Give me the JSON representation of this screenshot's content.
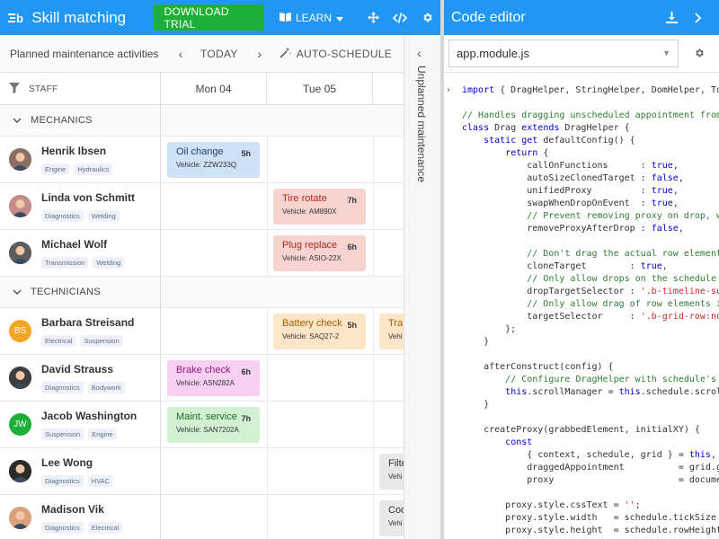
{
  "app": {
    "title": "Skill matching",
    "download_label": "DOWNLOAD TRIAL",
    "learn_label": "LEARN"
  },
  "toolbar": {
    "title": "Planned maintenance activities",
    "today_label": "TODAY",
    "auto_schedule_label": "AUTO-SCHEDULE"
  },
  "grid": {
    "staff_header": "STAFF",
    "days": [
      "Mon 04",
      "Tue 05"
    ]
  },
  "groups": [
    {
      "label": "MECHANICS",
      "staff": [
        {
          "name": "Henrik Ibsen",
          "tags": [
            "Engine",
            "Hydraulics"
          ],
          "avatar": "photo",
          "color": "#8d6e63",
          "events": [
            {
              "day": 0,
              "title": "Oil change",
              "duration": "5h",
              "vehicle": "Vehicle: ZZW233Q",
              "style": "blue"
            }
          ]
        },
        {
          "name": "Linda von Schmitt",
          "tags": [
            "Diagnostics",
            "Welding"
          ],
          "avatar": "photo",
          "color": "#c48b8b",
          "events": [
            {
              "day": 1,
              "title": "Tire rotate",
              "duration": "7h",
              "vehicle": "Vehicle: AM890X",
              "style": "red"
            }
          ]
        },
        {
          "name": "Michael Wolf",
          "tags": [
            "Transmission",
            "Welding"
          ],
          "avatar": "photo",
          "color": "#5d5d5d",
          "events": [
            {
              "day": 1,
              "title": "Plug replace",
              "duration": "6h",
              "vehicle": "Vehicle: ASIO-22X",
              "style": "red"
            }
          ]
        }
      ]
    },
    {
      "label": "TECHNICIANS",
      "staff": [
        {
          "name": "Barbara Streisand",
          "tags": [
            "Electrical",
            "Suspension"
          ],
          "avatar": "initials",
          "initials": "BS",
          "color": "#f4a523",
          "events": [
            {
              "day": 1,
              "title": "Battery check",
              "duration": "5h",
              "vehicle": "Vehicle: SAQ27-2",
              "style": "orange"
            },
            {
              "day": 2,
              "title": "Tra",
              "duration": "",
              "vehicle": "Vehi",
              "style": "orange"
            }
          ]
        },
        {
          "name": "David Strauss",
          "tags": [
            "Diagnostics",
            "Bodywork"
          ],
          "avatar": "photo",
          "color": "#3e3e3e",
          "events": [
            {
              "day": 0,
              "title": "Brake check",
              "duration": "6h",
              "vehicle": "Vehicle: ASN282A",
              "style": "pink"
            }
          ]
        },
        {
          "name": "Jacob Washington",
          "tags": [
            "Suspension",
            "Engine"
          ],
          "avatar": "initials",
          "initials": "JW",
          "color": "#1eaf39",
          "events": [
            {
              "day": 0,
              "title": "Maint. service",
              "duration": "7h",
              "vehicle": "Vehicle: SAN7202A",
              "style": "green"
            }
          ]
        },
        {
          "name": "Lee Wong",
          "tags": [
            "Diagnostics",
            "HVAC"
          ],
          "avatar": "photo",
          "color": "#2b2b2b",
          "events": [
            {
              "day": 2,
              "title": "Filte",
              "duration": "",
              "vehicle": "Vehi",
              "style": "gray"
            }
          ]
        },
        {
          "name": "Madison Vik",
          "tags": [
            "Diagnostics",
            "Electrical"
          ],
          "avatar": "photo",
          "color": "#d9a27a",
          "events": [
            {
              "day": 2,
              "title": "Coo",
              "duration": "",
              "vehicle": "Vehi",
              "style": "gray"
            }
          ]
        }
      ]
    }
  ],
  "unplanned": {
    "label": "Unplanned maintenance"
  },
  "editor": {
    "title": "Code editor",
    "file": "app.module.js",
    "lines": [
      "import { DragHelper, StringHelper, DomHelper, Toast",
      "",
      "// Handles dragging unscheduled appointment from th",
      "class Drag extends DragHelper {",
      "    static get defaultConfig() {",
      "        return {",
      "            callOnFunctions      : true,",
      "            autoSizeClonedTarget : false,",
      "            unifiedProxy         : true,",
      "            swapWhenDropOnEvent  : true,",
      "            // Prevent removing proxy on drop, we a",
      "            removeProxyAfterDrop : false,",
      "",
      "            // Don't drag the actual row element, c",
      "            cloneTarget        : true,",
      "            // Only allow drops on the schedule are",
      "            dropTargetSelector : '.b-timeline-subgr",
      "            // Only allow drag of row elements insi",
      "            targetSelector     : '.b-grid-row:not(.",
      "        };",
      "    }",
      "",
      "    afterConstruct(config) {",
      "        // Configure DragHelper with schedule's scr",
      "        this.scrollManager = this.schedule.scrollMa",
      "    }",
      "",
      "    createProxy(grabbedElement, initialXY) {",
      "        const",
      "            { context, schedule, grid } = this,",
      "            draggedAppointment          = grid.getR",
      "            proxy                       = document.",
      "",
      "        proxy.style.cssText = '';",
      "        proxy.style.width   = schedule.tickSize - (",
      "        proxy.style.height  = schedule.rowHeight -"
    ]
  },
  "colors": {
    "primary": "#2196f3",
    "download": "#1eaf39",
    "keyword": "#0000cc",
    "comment": "#2e7d32",
    "string": "#c62828"
  }
}
